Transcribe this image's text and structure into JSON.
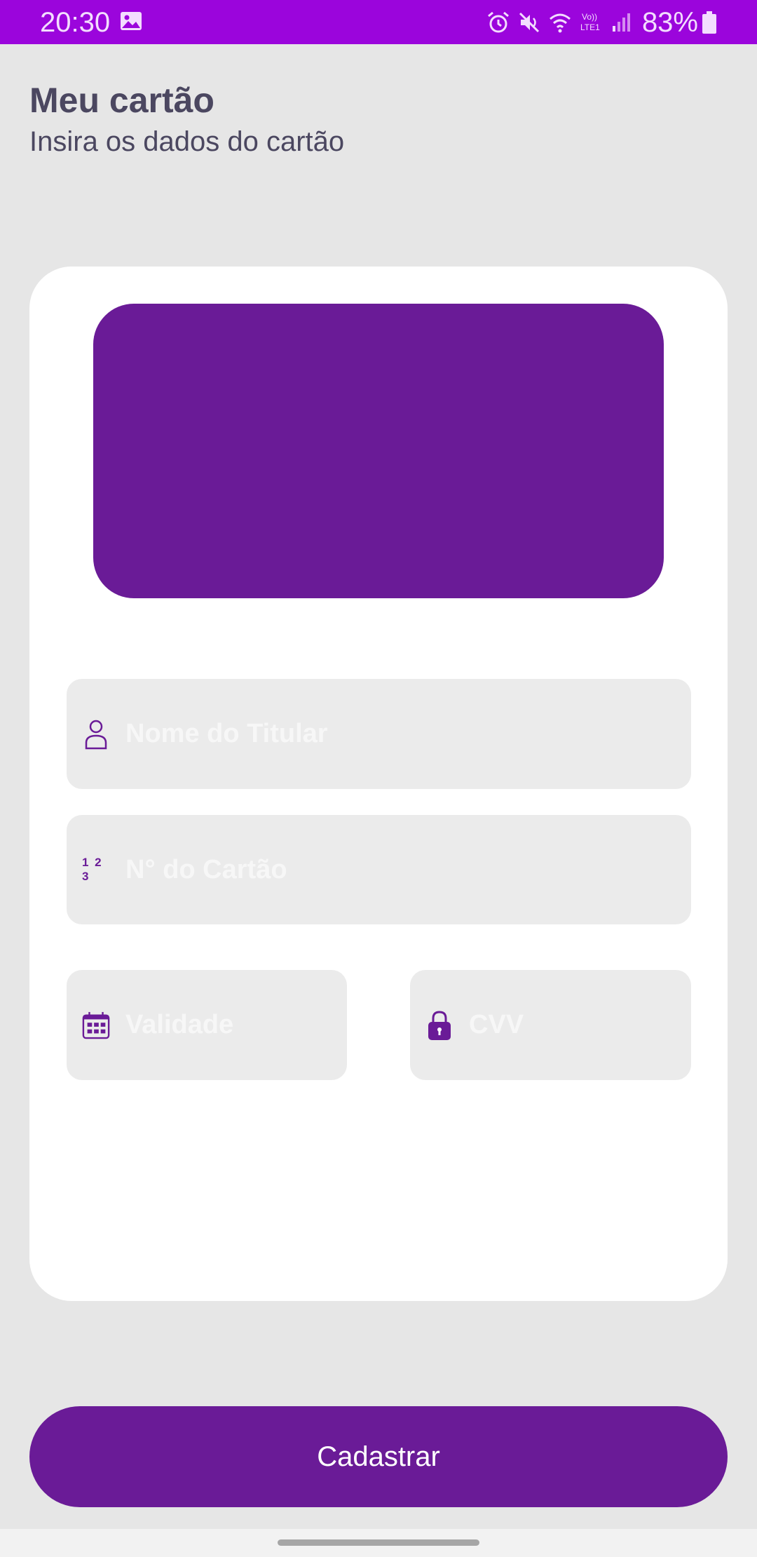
{
  "status_bar": {
    "time": "20:30",
    "battery": "83%",
    "icons": [
      "gallery-icon",
      "alarm-icon",
      "mute-icon",
      "wifi-icon",
      "volte-icon",
      "signal-icon",
      "battery-icon"
    ]
  },
  "header": {
    "title": "Meu cartão",
    "subtitle": "Insira os dados do cartão"
  },
  "form": {
    "holder_name": {
      "placeholder": "Nome do Titular",
      "value": "",
      "icon": "person-icon"
    },
    "card_number": {
      "placeholder": "N° do Cartão",
      "value": "",
      "icon": "numbers-icon",
      "icon_text": "1 2 3"
    },
    "validity": {
      "placeholder": "Validade",
      "value": "",
      "icon": "calendar-icon"
    },
    "cvv": {
      "placeholder": "CVV",
      "value": "",
      "icon": "lock-icon"
    }
  },
  "actions": {
    "submit_label": "Cadastrar"
  },
  "colors": {
    "status_bar": "#9b05dc",
    "accent": "#6a1b97",
    "background": "#e6e6e6",
    "panel": "#ffffff",
    "field": "#ebebeb",
    "title_text": "#4b4760"
  }
}
